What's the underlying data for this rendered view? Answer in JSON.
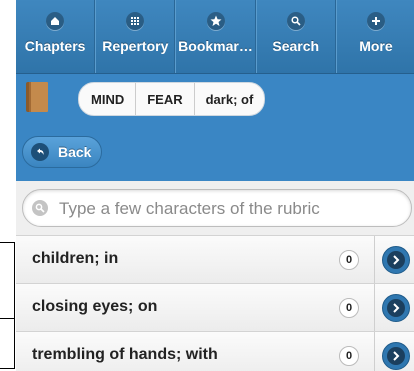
{
  "tabs": [
    {
      "label": "Chapters",
      "icon": "chapters-icon"
    },
    {
      "label": "Repertory",
      "icon": "repertory-icon"
    },
    {
      "label": "Bookmar…",
      "icon": "star-icon"
    },
    {
      "label": "Search",
      "icon": "search-icon"
    },
    {
      "label": "More",
      "icon": "plus-icon"
    }
  ],
  "breadcrumb": [
    "MIND",
    "FEAR",
    "dark; of"
  ],
  "back_label": "Back",
  "search": {
    "placeholder": "Type a few characters of the rubric",
    "value": ""
  },
  "rubrics": [
    {
      "label": "children; in",
      "count": "0"
    },
    {
      "label": "closing eyes; on",
      "count": "0"
    },
    {
      "label": "trembling of hands; with",
      "count": "0"
    }
  ],
  "colors": {
    "accent": "#3a86c4",
    "tabbar": "#3f87bf",
    "button_dark": "#1b3f5e"
  }
}
